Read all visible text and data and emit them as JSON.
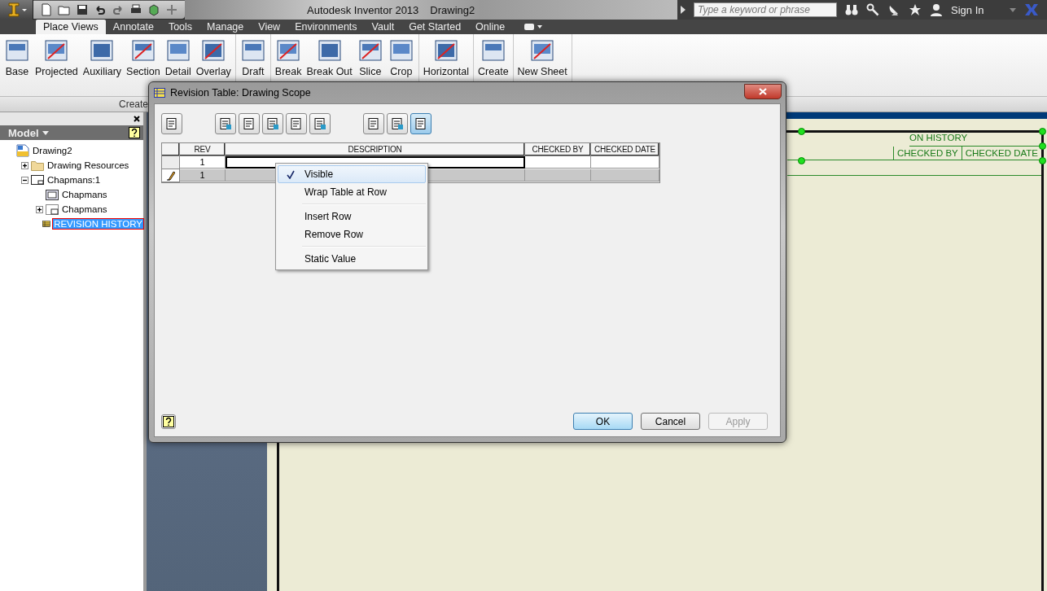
{
  "app": {
    "title": "Autodesk Inventor 2013",
    "document": "Drawing2"
  },
  "search": {
    "placeholder": "Type a keyword or phrase"
  },
  "sign_in": "Sign In",
  "ribbon_tabs": [
    {
      "label": "Place Views",
      "selected": true
    },
    {
      "label": "Annotate",
      "selected": false
    },
    {
      "label": "Tools",
      "selected": false
    },
    {
      "label": "Manage",
      "selected": false
    },
    {
      "label": "View",
      "selected": false
    },
    {
      "label": "Environments",
      "selected": false
    },
    {
      "label": "Vault",
      "selected": false
    },
    {
      "label": "Get Started",
      "selected": false
    },
    {
      "label": "Online",
      "selected": false
    }
  ],
  "ribbon_groups": [
    [
      "Base",
      "Projected",
      "Auxiliary",
      "Section",
      "Detail",
      "Overlay"
    ],
    [
      "Draft"
    ],
    [
      "Break",
      "Break Out",
      "Slice",
      "Crop"
    ],
    [
      "Horizontal"
    ],
    [
      "Create"
    ],
    [
      "New Sheet"
    ]
  ],
  "ribbon_panel_title": "Create",
  "browser": {
    "title": "Model",
    "tree": [
      {
        "label": "Drawing2",
        "kind": "drawing",
        "selected": false,
        "children": [
          {
            "label": "Drawing Resources",
            "kind": "folder",
            "expanded": false,
            "selected": false
          },
          {
            "label": "Chapmans:1",
            "kind": "sheet",
            "expanded": true,
            "selected": false,
            "children": [
              {
                "label": "Chapmans",
                "kind": "border",
                "selected": false
              },
              {
                "label": "Chapmans",
                "kind": "title-block",
                "expanded": false,
                "selected": false
              },
              {
                "label": "REVISION HISTORY",
                "kind": "table",
                "selected": true
              }
            ]
          }
        ]
      }
    ]
  },
  "sheet_table": {
    "title": "ON HISTORY",
    "columns": [
      "CHECKED BY",
      "CHECKED DATE"
    ]
  },
  "dialog": {
    "title": "Revision Table: Drawing Scope",
    "toolbar_groups": [
      [
        {
          "selected": false
        }
      ],
      [
        {
          "selected": false
        },
        {
          "selected": false
        },
        {
          "selected": false
        },
        {
          "selected": false
        },
        {
          "selected": false
        }
      ],
      [
        {
          "selected": false
        },
        {
          "selected": false
        },
        {
          "selected": true
        }
      ]
    ],
    "columns": [
      "REV",
      "DESCRIPTION",
      "CHECKED BY",
      "CHECKED DATE"
    ],
    "rows": [
      {
        "rev": "1",
        "editing": false
      },
      {
        "rev": "1",
        "editing": true
      }
    ],
    "context_menu": [
      {
        "label": "Visible",
        "checked": true,
        "selected": true,
        "separator_before": false
      },
      {
        "label": "Wrap Table at Row",
        "checked": false,
        "selected": false,
        "separator_before": false
      },
      {
        "label": "Insert Row",
        "checked": false,
        "selected": false,
        "separator_before": true
      },
      {
        "label": "Remove Row",
        "checked": false,
        "selected": false,
        "separator_before": false
      },
      {
        "label": "Static Value",
        "checked": false,
        "selected": false,
        "separator_before": true
      }
    ],
    "buttons": [
      {
        "label": "OK",
        "kind": "default",
        "disabled": false
      },
      {
        "label": "Cancel",
        "kind": "normal",
        "disabled": false
      },
      {
        "label": "Apply",
        "kind": "normal",
        "disabled": true
      }
    ]
  }
}
